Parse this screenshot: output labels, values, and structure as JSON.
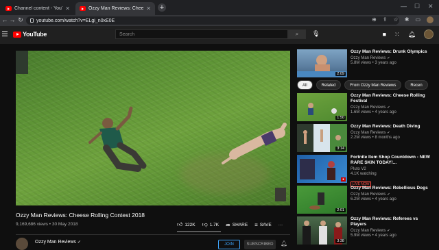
{
  "browser": {
    "tabs": [
      {
        "title": "Channel content - YouTube Studio",
        "active": false
      },
      {
        "title": "Ozzy Man Reviews: Cheese Rollin",
        "active": true
      }
    ],
    "new_tab": "+",
    "url": "youtube.com/watch?v=ELgi_n0xE0E"
  },
  "masthead": {
    "logo_text": "YouTube",
    "search_placeholder": "Search"
  },
  "video": {
    "title": "Ozzy Man Reviews: Cheese Rolling Contest 2018",
    "meta": "9,169,686 views • 30 May 2018",
    "likes": "122K",
    "dislikes": "1.7K",
    "share_label": "SHARE",
    "save_label": "SAVE",
    "more": "···",
    "channel_name": "Ozzy Man Reviews",
    "join_label": "JOIN",
    "subscribed_label": "SUBSCRIBED"
  },
  "sidebar": {
    "chips": [
      "All",
      "Related",
      "From Ozzy Man Reviews",
      "Recen"
    ],
    "recommendations": [
      {
        "title": "Ozzy Man Reviews: Drunk Olympics",
        "channel": "Ozzy Man Reviews",
        "views": "5.8M views • 3 years ago",
        "duration": "2:09",
        "thumb_color": "#5d7fa0"
      },
      {
        "title": "Ozzy Man Reviews: Cheese Rolling Festival",
        "channel": "Ozzy Man Reviews",
        "views": "1.6M views • 4 years ago",
        "duration": "1:50",
        "thumb_color": "#5f9a3a"
      },
      {
        "title": "Ozzy Man Reviews: Death Diving",
        "channel": "Ozzy Man Reviews",
        "views": "2.2M views • 8 months ago",
        "duration": "3:14",
        "thumb_color": "#4a8a3c"
      },
      {
        "title": "Fortnite Item Shop Countdown - NEW RARE SKIN TODAY!...",
        "channel": "Pluto V2",
        "views": "4.1K watching",
        "live": "LIVE NOW",
        "thumb_color": "#2a6fb0"
      },
      {
        "title": "Ozzy Man Reviews: Rebellious Dogs",
        "channel": "Ozzy Man Reviews",
        "views": "6.2M views • 4 years ago",
        "duration": "2:01",
        "thumb_color": "#3d8a3a"
      },
      {
        "title": "Ozzy Man Reviews: Referees vs Players",
        "channel": "Ozzy Man Reviews",
        "views": "5.9M views • 4 years ago",
        "duration": "3:38",
        "thumb_color": "#3a4a3a"
      }
    ]
  }
}
